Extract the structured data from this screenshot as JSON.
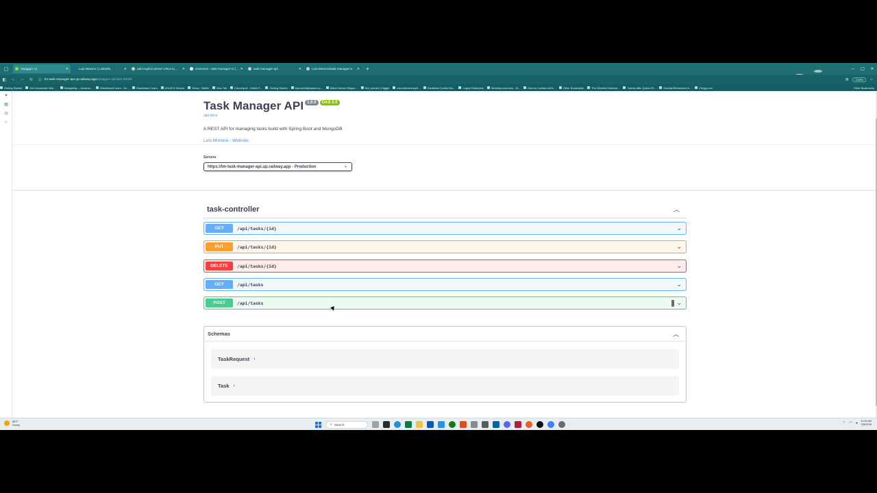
{
  "browser": {
    "tabs": [
      {
        "title": "Swagger UI",
        "active": true,
        "favicon_color": "#85ea2d"
      },
      {
        "title": "Luis Moreno | LinkedIn",
        "active": false,
        "favicon_color": "#0a66c2"
      },
      {
        "title": "add explicit server URLs to Swa",
        "active": false,
        "favicon_color": "#cccccc"
      },
      {
        "title": "Overview - task-manager-m | Lu",
        "active": false,
        "favicon_color": "#ffffff"
      },
      {
        "title": "task-manager-api",
        "active": false,
        "favicon_color": "#cccccc"
      },
      {
        "title": "Luis-Moreno/task-manager-a",
        "active": false,
        "favicon_color": "#cccccc"
      }
    ],
    "address": {
      "host": "lm-task-manager-api.up.railway.app",
      "path": "/swagger-ui/index.html#/"
    },
    "zoom": "133%",
    "bookmarks": [
      "Getting Started",
      "Get Homework Help ...",
      "Navigating — Amazon...",
      "Blackboard Learn - Se...",
      "Blackboard Learn",
      "ASUS E-Service",
      "Home - Netflix",
      "New Tab",
      "Crunchyroll - Watch P...",
      "Getting Started",
      "MyLiveWallpapers.co...",
      "Watch Naruto Shippu...",
      "fish_market | Kaggle",
      "microelectronics&...",
      "Breakfast Combo Bur...",
      "Legion Enterprise",
      "Workday cinemark - Si...",
      "How do I extract all th...",
      "Other Bookmarks",
      "The Wireless Network...",
      "Tweets after Queen El...",
      "Suicidal Behaviours A...",
      "Chegg.com"
    ],
    "other_bookmarks": "Other Bookmarks"
  },
  "swagger": {
    "title": "Task Manager API",
    "version": "1.0.0",
    "oas": "OAS 3.0",
    "api_docs_link": "/api-docs",
    "description": "A REST API for managing tasks build with Spring Boot and MongoDB",
    "contact": "Luis Moreno - Website",
    "servers_label": "Servers",
    "selected_server": "https://lm-task-manager-api.up.railway.app - Production",
    "tag": "task-controller",
    "operations": [
      {
        "method": "GET",
        "path": "/api/tasks/{id}",
        "color": "#61affe"
      },
      {
        "method": "PUT",
        "path": "/api/tasks/{id}",
        "color": "#fca130"
      },
      {
        "method": "DELETE",
        "path": "/api/tasks/{id}",
        "color": "#f93e3e"
      },
      {
        "method": "GET",
        "path": "/api/tasks",
        "color": "#61affe"
      },
      {
        "method": "POST",
        "path": "/api/tasks",
        "color": "#49cc90"
      }
    ],
    "schemas_title": "Schemas",
    "schemas": [
      "TaskRequest",
      "Task"
    ]
  },
  "taskbar": {
    "weather_temp": "88°F",
    "weather_desc": "Sunny",
    "search_placeholder": "Search",
    "time": "11:36 AM",
    "date": "5/8/2026"
  },
  "icons": {
    "chevron_down": "chevron-down-icon",
    "chevron_up": "chevron-up-icon",
    "lock": "lock-icon",
    "search": "search-icon"
  }
}
